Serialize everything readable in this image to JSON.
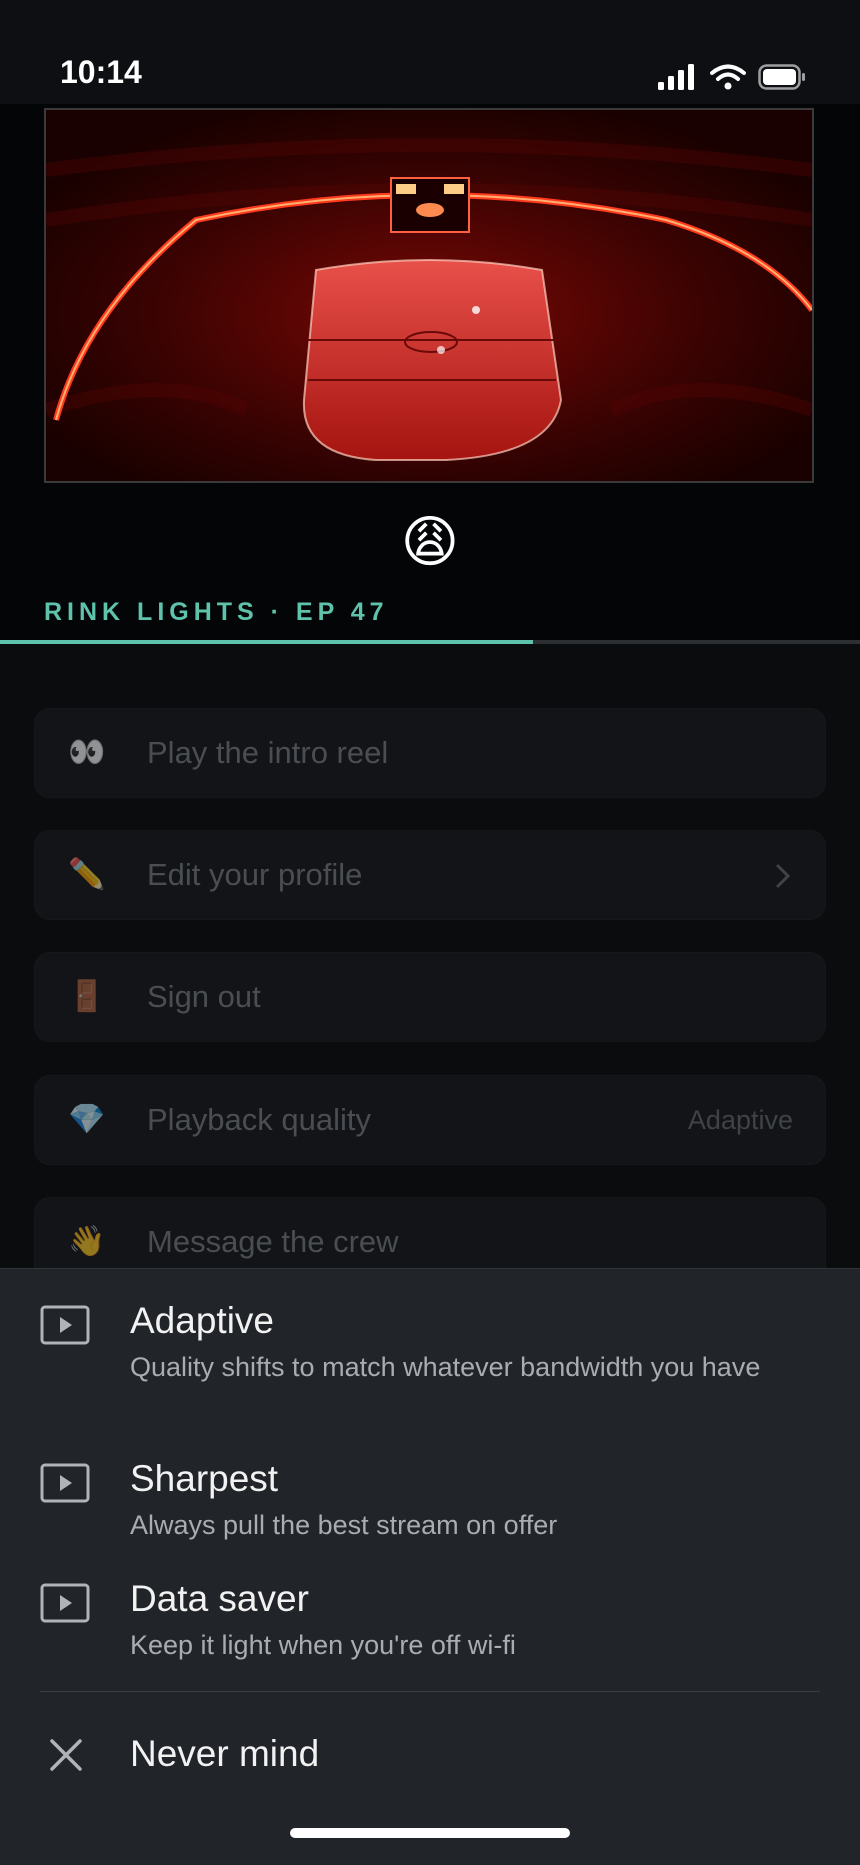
{
  "status_bar": {
    "time": "10:14"
  },
  "hero": {
    "reaction_emoji": "😩"
  },
  "episode": {
    "label": "RINK LIGHTS · EP 47",
    "progress_fraction": 0.62
  },
  "menu": {
    "items": [
      {
        "icon": "👀",
        "icon_name": "eyes-icon",
        "label": "Play the intro reel"
      },
      {
        "icon": "✏️",
        "icon_name": "pencil-icon",
        "label": "Edit your profile"
      },
      {
        "icon": "🚪",
        "icon_name": "door-icon",
        "label": "Sign out"
      },
      {
        "icon": "💎",
        "icon_name": "gem-icon",
        "label": "Playback quality",
        "value": "Adaptive"
      },
      {
        "icon": "👋",
        "icon_name": "waving-hand-icon",
        "label": "Message the crew"
      }
    ]
  },
  "sheet": {
    "options": [
      {
        "title": "Adaptive",
        "description": "Quality shifts to match whatever bandwidth you have"
      },
      {
        "title": "Sharpest",
        "description": "Always pull the best stream on offer"
      },
      {
        "title": "Data saver",
        "description": "Keep it light when you're off wi-fi"
      }
    ],
    "cancel_label": "Never mind"
  },
  "colors": {
    "accent": "#5fc3ac",
    "sheet_bg": "#212428",
    "page_bg": "#040507"
  }
}
